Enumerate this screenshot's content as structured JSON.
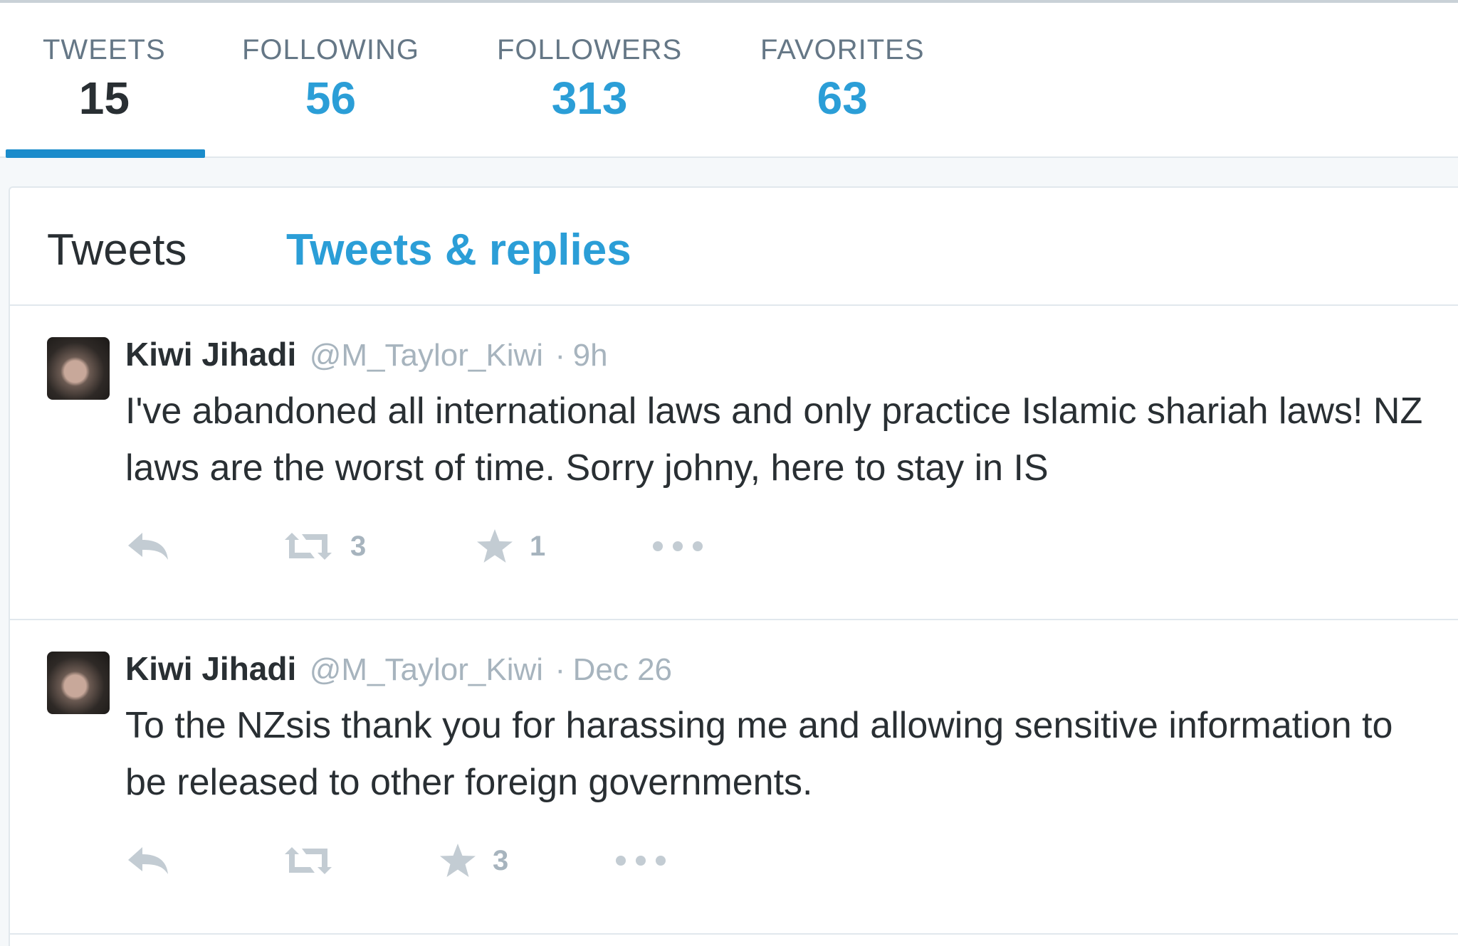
{
  "stats": [
    {
      "label": "TWEETS",
      "value": "15"
    },
    {
      "label": "FOLLOWING",
      "value": "56"
    },
    {
      "label": "FOLLOWERS",
      "value": "313"
    },
    {
      "label": "FAVORITES",
      "value": "63"
    }
  ],
  "tabs": {
    "tweets": "Tweets",
    "replies": "Tweets & replies"
  },
  "tweets": [
    {
      "name": "Kiwi Jihadi",
      "handle": "@M_Taylor_Kiwi",
      "sep": "·",
      "time": "9h",
      "text": "I've abandoned all international laws and only practice Islamic shariah laws! NZ laws are the worst of time. Sorry johny, here to stay in IS",
      "retweets": "3",
      "favorites": "1"
    },
    {
      "name": "Kiwi Jihadi",
      "handle": "@M_Taylor_Kiwi",
      "sep": "·",
      "time": "Dec 26",
      "text": "To the NZsis thank you for harassing me and allowing sensitive information to be released to other foreign governments.",
      "retweets": "",
      "favorites": "3"
    }
  ],
  "icons": {
    "reply": "reply-icon",
    "retweet": "retweet-icon",
    "favorite": "star-icon",
    "more": "more-icon"
  },
  "colors": {
    "accent": "#2b9ed7",
    "text": "#292f33",
    "muted": "#a7b4be",
    "active_underline": "#1b8ccb"
  }
}
